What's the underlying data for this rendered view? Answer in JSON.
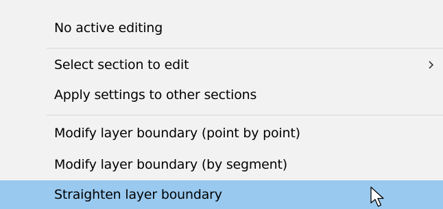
{
  "menu": {
    "items": [
      {
        "label": "No active editing"
      },
      {
        "label": "Select section to edit",
        "submenu_indicator": "chevron-right-icon"
      },
      {
        "label": "Apply settings to other sections"
      },
      {
        "label": "Modify layer boundary (point by point)"
      },
      {
        "label": "Modify layer boundary (by segment)"
      },
      {
        "label": "Straighten layer boundary",
        "state": "highlighted"
      }
    ],
    "colors": {
      "background": "#f2f2f2",
      "highlight": "#99c9ef",
      "separator": "#d7d7d7",
      "text": "#000000"
    }
  },
  "cursor": {
    "icon": "arrow-pointer-icon"
  }
}
